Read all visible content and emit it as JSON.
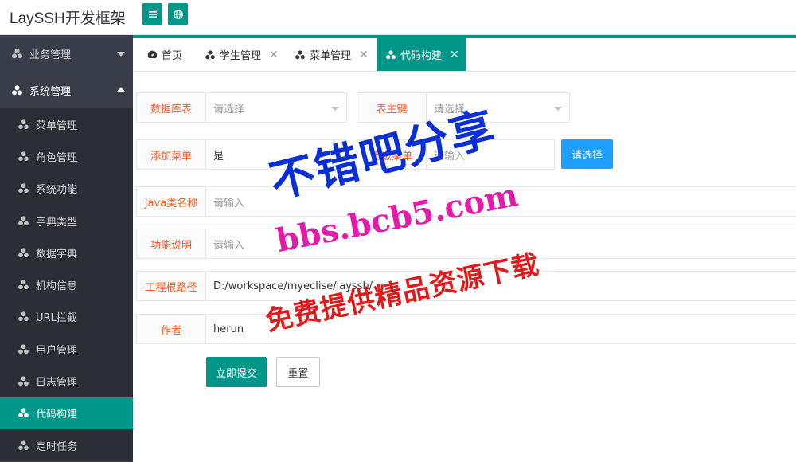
{
  "header": {
    "title": "LaySSH开发框架"
  },
  "sidebar": {
    "groups": [
      {
        "label": "业务管理",
        "expanded": false
      },
      {
        "label": "系统管理",
        "expanded": true
      }
    ],
    "items": [
      {
        "label": "菜单管理"
      },
      {
        "label": "角色管理"
      },
      {
        "label": "系统功能"
      },
      {
        "label": "字典类型"
      },
      {
        "label": "数据字典"
      },
      {
        "label": "机构信息"
      },
      {
        "label": "URL拦截"
      },
      {
        "label": "用户管理"
      },
      {
        "label": "日志管理"
      },
      {
        "label": "代码构建",
        "active": true
      },
      {
        "label": "定时任务"
      }
    ]
  },
  "tabs": [
    {
      "label": "首页"
    },
    {
      "label": "学生管理"
    },
    {
      "label": "菜单管理"
    },
    {
      "label": "代码构建",
      "active": true
    }
  ],
  "form": {
    "table_label": "数据库表",
    "table_placeholder": "请选择",
    "pk_label": "表主键",
    "pk_placeholder": "请选择",
    "menu_label": "添加菜单",
    "menu_value": "是",
    "parent_menu_label": "上级菜单",
    "parent_menu_placeholder": "请输入",
    "choose_button": "请选择",
    "class_label": "Java类名称",
    "class_placeholder": "请输入",
    "desc_label": "功能说明",
    "desc_placeholder": "请输入",
    "root_label": "工程根路径",
    "root_value": "D:/workspace/myeclise/layssh/",
    "author_label": "作者",
    "author_value": "herun",
    "submit_button": "立即提交",
    "reset_button": "重置"
  },
  "watermark": {
    "line1": "不错吧分享",
    "line2": "bbs.bcb5.com",
    "line3": "免费提供精品资源下载"
  },
  "colors": {
    "accent": "#009688",
    "sidebar": "#393d49",
    "blue": "#1e9fff",
    "label_text": "#ff5722"
  }
}
